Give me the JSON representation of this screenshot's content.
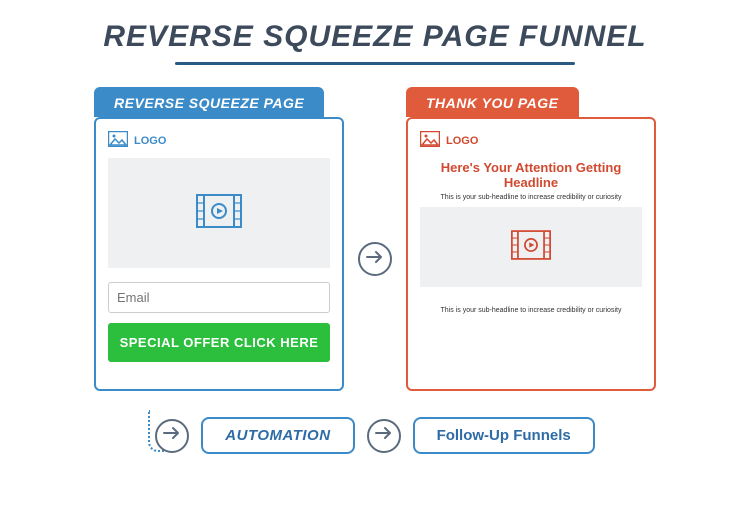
{
  "title": "REVERSE SQUEEZE PAGE FUNNEL",
  "left": {
    "tab": "REVERSE SQUEEZE PAGE",
    "logo": "LOGO",
    "email_placeholder": "Email",
    "cta": "SPECIAL OFFER CLICK HERE"
  },
  "right": {
    "tab": "THANK YOU PAGE",
    "logo": "LOGO",
    "headline": "Here's Your Attention Getting Headline",
    "subhead": "This is your sub-headline to increase credibility or curiosity"
  },
  "bottom": {
    "automation": "AUTOMATION",
    "followup": "Follow-Up Funnels"
  }
}
